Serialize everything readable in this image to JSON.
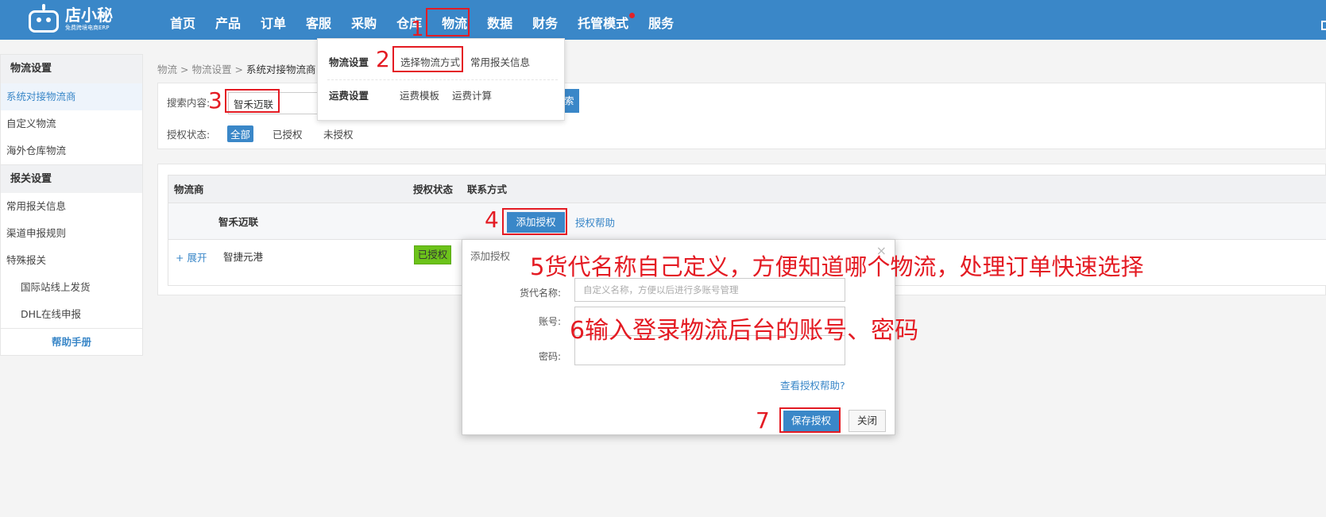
{
  "brand": {
    "name": "店小秘",
    "tagline": "免费跨境电商ERP"
  },
  "nav": [
    {
      "label": "首页"
    },
    {
      "label": "产品"
    },
    {
      "label": "订单"
    },
    {
      "label": "客服"
    },
    {
      "label": "采购"
    },
    {
      "label": "仓库"
    },
    {
      "label": "物流"
    },
    {
      "label": "数据"
    },
    {
      "label": "财务"
    },
    {
      "label": "托管模式"
    },
    {
      "label": "服务"
    }
  ],
  "dropdown": {
    "group1_label": "物流设置",
    "group1_items": [
      "选择物流方式",
      "常用报关信息"
    ],
    "group2_label": "运费设置",
    "group2_items": [
      "运费模板",
      "运费计算"
    ]
  },
  "sidebar": {
    "section1": "物流设置",
    "items1": [
      "系统对接物流商",
      "自定义物流",
      "海外仓库物流"
    ],
    "section2": "报关设置",
    "items2": [
      "常用报关信息",
      "渠道申报规则",
      "特殊报关"
    ],
    "subitems": [
      "国际站线上发货",
      "DHL在线申报"
    ],
    "help": "帮助手册"
  },
  "breadcrumb": {
    "a": "物流",
    "sep": ">",
    "b": "物流设置",
    "c": "系统对接物流商"
  },
  "search": {
    "label": "搜索内容:",
    "value": "智禾迈联",
    "button": "索",
    "status_label": "授权状态:",
    "filters": [
      "全部",
      "已授权",
      "未授权"
    ]
  },
  "table": {
    "headers": [
      "物流商",
      "授权状态",
      "联系方式"
    ],
    "group_name": "智禾迈联",
    "add_auth": "添加授权",
    "auth_help": "授权帮助",
    "row": {
      "expand": "+ 展开",
      "name": "智捷元港",
      "status": "已授权"
    }
  },
  "modal": {
    "title": "添加授权",
    "close": "×",
    "name_label": "货代名称:",
    "name_placeholder": "自定义名称，方便以后进行多账号管理",
    "account_label": "账号:",
    "password_label": "密码:",
    "help_link": "查看授权帮助?",
    "save": "保存授权",
    "cancel": "关闭"
  },
  "annotations": {
    "n1": "1",
    "n2": "2",
    "n3": "3",
    "n4": "4",
    "n7": "7",
    "n5": "5货代名称自己定义，方便知道哪个物流，处理订单快速选择",
    "n6": "6输入登录物流后台的账号、密码"
  },
  "colors": {
    "primary": "#3a87c8",
    "annotation": "#e41b23",
    "authorized": "#6cc31a"
  }
}
